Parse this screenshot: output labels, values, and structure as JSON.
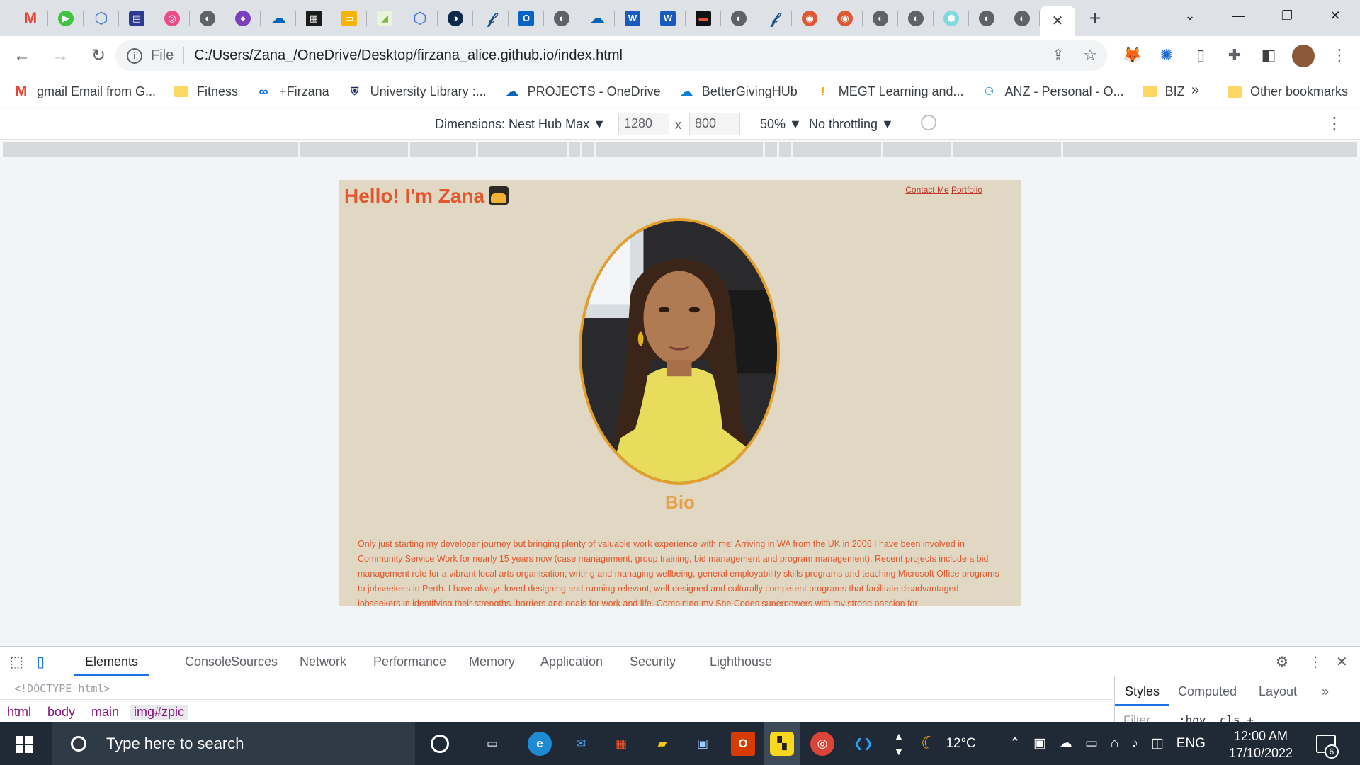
{
  "browser": {
    "active_tab_close": "✕",
    "new_tab": "+",
    "window_controls": {
      "tab_search": "⌄",
      "minimize": "—",
      "restore": "❐",
      "close": "✕"
    },
    "omnibox": {
      "scheme": "File",
      "url": "C:/Users/Zana_/OneDrive/Desktop/firzana_alice.github.io/index.html"
    },
    "bookmarks": [
      {
        "label": "gmail Email from G...",
        "icon": "gmail-icon"
      },
      {
        "label": "Fitness",
        "icon": "folder-icon"
      },
      {
        "label": "+Firzana",
        "icon": "meta-icon"
      },
      {
        "label": "University Library :...",
        "icon": "shield-icon"
      },
      {
        "label": "PROJECTS - OneDrive",
        "icon": "onedrive-icon"
      },
      {
        "label": "BetterGivingHUb",
        "icon": "cloud-icon"
      },
      {
        "label": "MEGT Learning and...",
        "icon": "megt-icon"
      },
      {
        "label": "ANZ - Personal - O...",
        "icon": "anz-icon"
      },
      {
        "label": "BIZ",
        "icon": "folder-icon"
      }
    ],
    "bookmarks_more": "»",
    "other_bookmarks": "Other bookmarks"
  },
  "device_toolbar": {
    "dimensions_label": "Dimensions: Nest Hub Max ▼",
    "width": "1280",
    "times": "x",
    "height": "800",
    "zoom": "50% ▼",
    "throttling": "No throttling ▼"
  },
  "site": {
    "title": "Hello! I'm Zana",
    "links": [
      "Contact Me",
      "Portfolio"
    ],
    "bio_heading": "Bio",
    "bio_text": "Only just starting my developer journey but bringing plenty of valuable work experience with me! Arriving in WA from the UK in 2006 I have been involved in Community Service Work for nearly 15 years now (case management, group training, bid management and program management). Recent projects include a bid management role for a vibrant local arts organisation; writing and managing wellbeing, general employability skills programs and teaching Microsoft Office programs to jobseekers in Perth. I have always loved designing and running relevant, well-designed and culturally competent programs that facilitate disadvantaged jobseekers in identifying their strengths, barriers and goals for work and life. Combining my She Codes superpowers with my strong passion for"
  },
  "devtools": {
    "tabs": [
      "Elements",
      "Console",
      "Sources",
      "Network",
      "Performance",
      "Memory",
      "Application",
      "Security",
      "Lighthouse"
    ],
    "doctype": "<!DOCTYPE html>",
    "breadcrumbs": [
      "html",
      "body",
      "main",
      "img#zpic"
    ],
    "side_tabs": [
      "Styles",
      "Computed",
      "Layout"
    ],
    "side_more": "»",
    "filter_placeholder": "Filter",
    "hov_cls": ":hov  .cls  +"
  },
  "taskbar": {
    "search_placeholder": "Type here to search",
    "weather": "12°C",
    "language": "ENG",
    "time": "12:00 AM",
    "date": "17/10/2022",
    "notifications": "6"
  },
  "colors": {
    "site_background": "#e0d8c3",
    "title_red": "#e4572e",
    "bio_heading": "#e6a24b",
    "portrait_border": "#e3a02f",
    "devtools_accent": "#1a73e8"
  }
}
